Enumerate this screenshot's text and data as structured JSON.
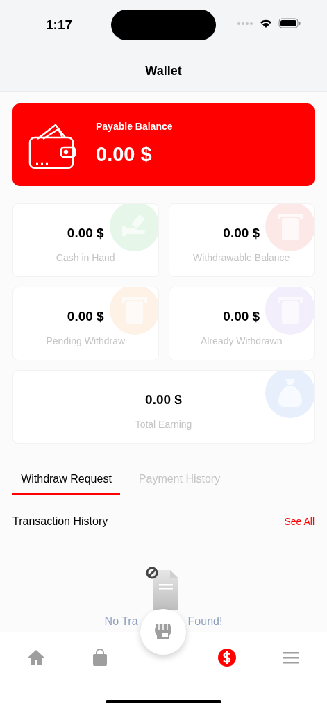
{
  "status_bar": {
    "time": "1:17"
  },
  "header": {
    "title": "Wallet"
  },
  "balance_card": {
    "label": "Payable Balance",
    "amount": "0.00 $"
  },
  "stats": [
    {
      "amount": "0.00 $",
      "label": "Cash in Hand",
      "kind": "cash",
      "color": "#e6f7ea"
    },
    {
      "amount": "0.00 $",
      "label": "Withdrawable Balance",
      "kind": "atm",
      "color": "#fde8e8"
    },
    {
      "amount": "0.00 $",
      "label": "Pending Withdraw",
      "kind": "atm",
      "color": "#fef1e6"
    },
    {
      "amount": "0.00 $",
      "label": "Already Withdrawn",
      "kind": "atm",
      "color": "#f2eefb"
    },
    {
      "amount": "0.00 $",
      "label": "Total Earning",
      "kind": "moneybag",
      "color": "#e7effc"
    }
  ],
  "tabs": [
    {
      "label": "Withdraw Request",
      "selected": true
    },
    {
      "label": "Payment History",
      "selected": false
    }
  ],
  "section": {
    "title": "Transaction History",
    "link": "See All"
  },
  "empty_state": {
    "message_start": "No Tra",
    "message_end": "Found!"
  },
  "bottom_nav": [
    {
      "kind": "home",
      "selected": false
    },
    {
      "kind": "bag",
      "selected": false
    },
    {
      "kind": "store",
      "selected": false
    },
    {
      "kind": "dollar",
      "selected": true
    },
    {
      "kind": "menu",
      "selected": false
    }
  ]
}
